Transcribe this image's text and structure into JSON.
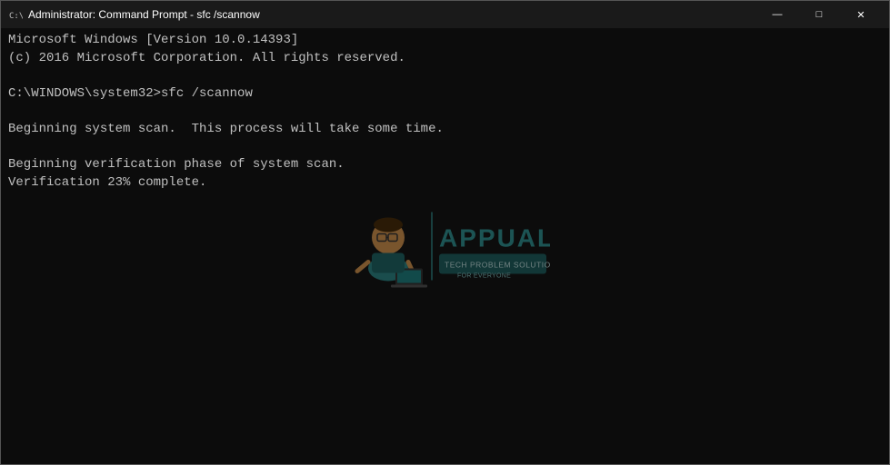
{
  "window": {
    "title": "Administrator: Command Prompt - sfc  /scannow",
    "icon": "cmd-icon"
  },
  "titlebar": {
    "minimize_label": "—",
    "maximize_label": "□",
    "close_label": "✕"
  },
  "terminal": {
    "lines": [
      "Microsoft Windows [Version 10.0.14393]",
      "(c) 2016 Microsoft Corporation. All rights reserved.",
      "",
      "C:\\WINDOWS\\system32>sfc /scannow",
      "",
      "Beginning system scan.  This process will take some time.",
      "",
      "Beginning verification phase of system scan.",
      "Verification 23% complete."
    ]
  }
}
